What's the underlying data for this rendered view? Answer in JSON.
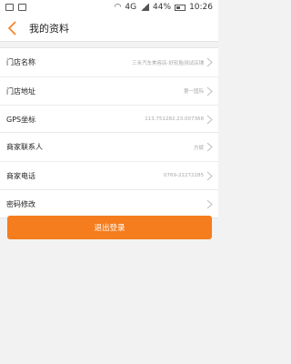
{
  "statusbar": {
    "network": "4G",
    "battery": "44%",
    "time": "10:26"
  },
  "header": {
    "title": "我的资料"
  },
  "store_info": [
    {
      "label": "门店名称",
      "value": "三禾汽车美容店-好轮胎测试店铺"
    },
    {
      "label": "门店地址",
      "value": "第一国际"
    },
    {
      "label": "GPS坐标",
      "value": "113.751282,23.007368"
    }
  ],
  "merchant_info": [
    {
      "label": "商家联系人",
      "value": "方斌"
    },
    {
      "label": "商家电话",
      "value": "0769-22272285"
    },
    {
      "label": "密码修改",
      "value": ""
    }
  ],
  "logout_label": "退出登录",
  "colors": {
    "accent": "#f57d1e",
    "background": "#f2f2f2"
  }
}
